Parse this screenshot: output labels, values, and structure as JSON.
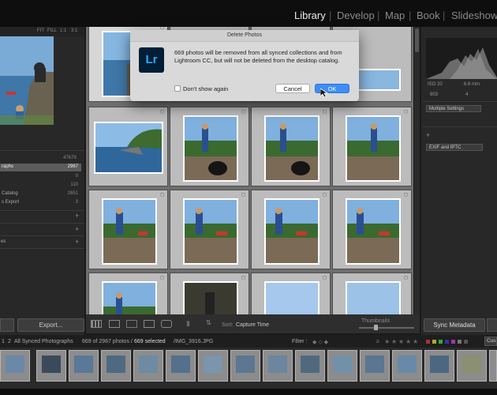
{
  "modules": {
    "items": [
      "Library",
      "Develop",
      "Map",
      "Book",
      "Slideshow"
    ],
    "active": "Library"
  },
  "navigator": {
    "options": [
      "FIT",
      "FILL",
      "1:1",
      "3:1"
    ]
  },
  "catalog": {
    "top_count": "47679",
    "rows": [
      {
        "label": "raphs",
        "count": "2967",
        "selected": true
      },
      {
        "label": "",
        "count": "0"
      },
      {
        "label": "",
        "count": "110"
      },
      {
        "label": "Catalog",
        "count": "2651"
      },
      {
        "label": "s Export",
        "count": "3"
      }
    ],
    "extra_label": "es"
  },
  "left_buttons": {
    "export_label": "Export..."
  },
  "toolbar": {
    "sort_label": "Sort:",
    "sort_value": "Capture Time",
    "thumbnails_label": "Thumbnails"
  },
  "right_panel": {
    "iso": "ISO 20",
    "focal": "6.6 mm",
    "count_a": "603",
    "count_b": "4",
    "settings_dropdown": "Multiple Settings",
    "metadata_dropdown": "EXIF and IPTC",
    "sync_label": "Sync Metadata"
  },
  "filmbar": {
    "page_nums": [
      "1",
      "2"
    ],
    "source": "All Synced Photographs",
    "summary_pre": "669 of 2967 photos /",
    "summary_sel": "669 selected",
    "summary_file": "/IMG_3916.JPG",
    "filter_label": "Filter :",
    "custom_label": "Cus"
  },
  "dialog": {
    "title": "Delete Photos",
    "logo_text": "Lr",
    "message": "669 photos will be removed from all synced collections and from Lightroom CC, but will not be deleted from the desktop catalog.",
    "checkbox_label": "Don't show again",
    "cancel_label": "Cancel",
    "ok_label": "OK"
  },
  "colors": {
    "dialog_bg": "#d9d9d9",
    "ok_blue": "#3d8ef5",
    "lr_bg": "#001e36",
    "lr_fg": "#31a8ff",
    "grid_bg": "#6e6e6e"
  }
}
